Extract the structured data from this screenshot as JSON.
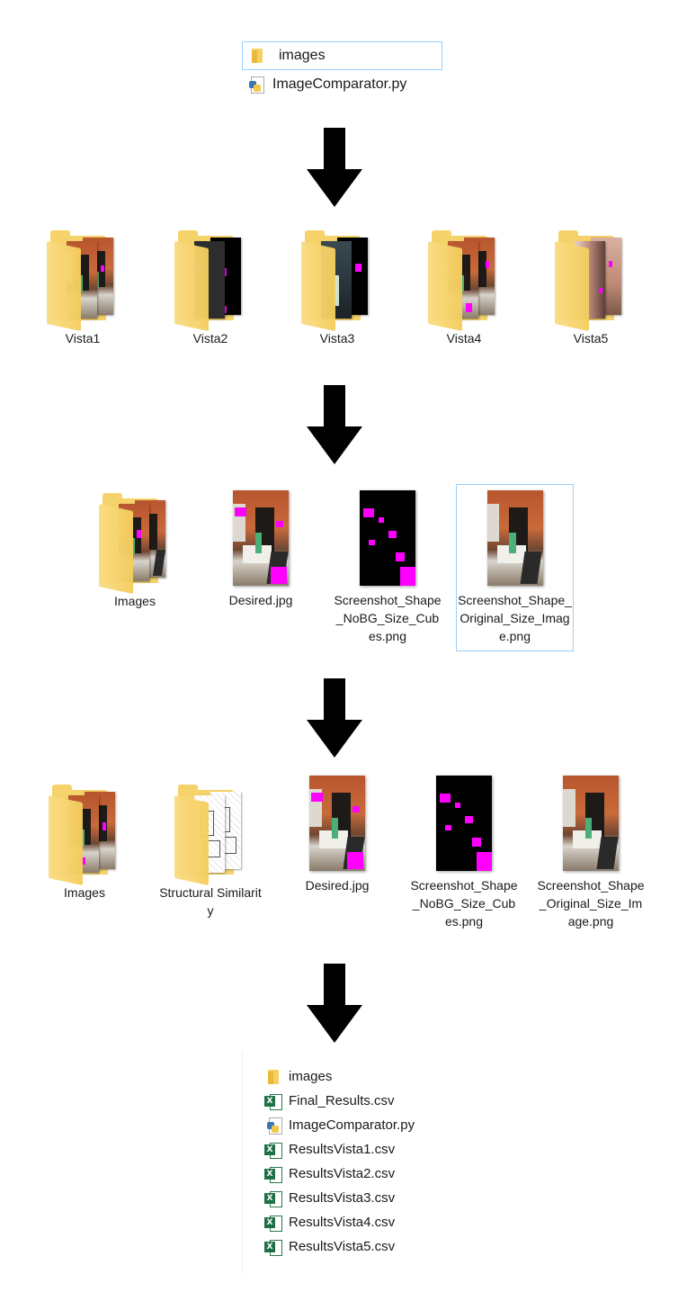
{
  "top_listing": {
    "items": [
      {
        "label": "images",
        "icon": "folder-icon",
        "selected": true
      },
      {
        "label": "ImageComparator.py",
        "icon": "python-file-icon",
        "selected": false
      }
    ]
  },
  "row1": {
    "folders": [
      {
        "label": "Vista1"
      },
      {
        "label": "Vista2"
      },
      {
        "label": "Vista3"
      },
      {
        "label": "Vista4"
      },
      {
        "label": "Vista5"
      }
    ]
  },
  "row2": {
    "items": [
      {
        "label": "Images",
        "kind": "folder"
      },
      {
        "label": "Desired.jpg",
        "kind": "photo"
      },
      {
        "label": "Screenshot_Shape_NoBG_Size_Cubes.png",
        "kind": "cubes"
      },
      {
        "label": "Screenshot_Shape_Original_Size_Image.png",
        "kind": "photo",
        "selected": true
      }
    ]
  },
  "row3": {
    "items": [
      {
        "label": "Images",
        "kind": "folder"
      },
      {
        "label": "Structural Similarity",
        "kind": "folder"
      },
      {
        "label": "Desired.jpg",
        "kind": "photo"
      },
      {
        "label": "Screenshot_Shape_NoBG_Size_Cubes.png",
        "kind": "cubes"
      },
      {
        "label": "Screenshot_Shape_Original_Size_Image.png",
        "kind": "photo"
      }
    ]
  },
  "bottom_listing": {
    "items": [
      {
        "label": "images",
        "icon": "folder-icon"
      },
      {
        "label": "Final_Results.csv",
        "icon": "excel-csv-icon"
      },
      {
        "label": "ImageComparator.py",
        "icon": "python-file-icon"
      },
      {
        "label": "ResultsVista1.csv",
        "icon": "excel-csv-icon"
      },
      {
        "label": "ResultsVista2.csv",
        "icon": "excel-csv-icon"
      },
      {
        "label": "ResultsVista3.csv",
        "icon": "excel-csv-icon"
      },
      {
        "label": "ResultsVista4.csv",
        "icon": "excel-csv-icon"
      },
      {
        "label": "ResultsVista5.csv",
        "icon": "excel-csv-icon"
      }
    ]
  },
  "colors": {
    "arrow": "#000000",
    "selection_border": "#99d1ff",
    "cube": "#ff00ff",
    "folder": "#f6d36a",
    "excel": "#1e7145"
  }
}
